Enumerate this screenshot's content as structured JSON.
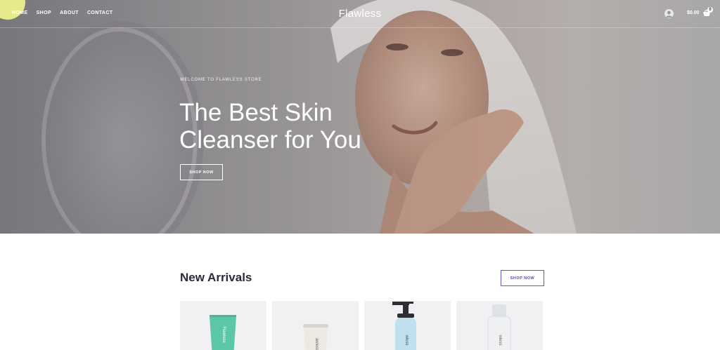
{
  "nav": {
    "links": [
      "HOME",
      "SHOP",
      "ABOUT",
      "CONTACT"
    ],
    "brand": "Flawless",
    "cart_total": "$0.00",
    "cart_count": "0"
  },
  "hero": {
    "eyebrow": "WELCOME TO FLAWLESS STORE",
    "title_line1": "The Best Skin",
    "title_line2": "Cleanser for You",
    "cta": "SHOP NOW"
  },
  "arrivals": {
    "title": "New Arrivals",
    "cta": "SHOP NOW",
    "products": [
      {
        "label": "Flawless",
        "color": "#5cc7a6"
      },
      {
        "label": "awless",
        "color": "#ece8e2"
      },
      {
        "label": "wless",
        "color": "#bfe0ec"
      },
      {
        "label": "wless",
        "color": "#eef0f2"
      }
    ]
  },
  "colors": {
    "accent": "#e6ea8a",
    "button_border": "#5b5bd0"
  }
}
